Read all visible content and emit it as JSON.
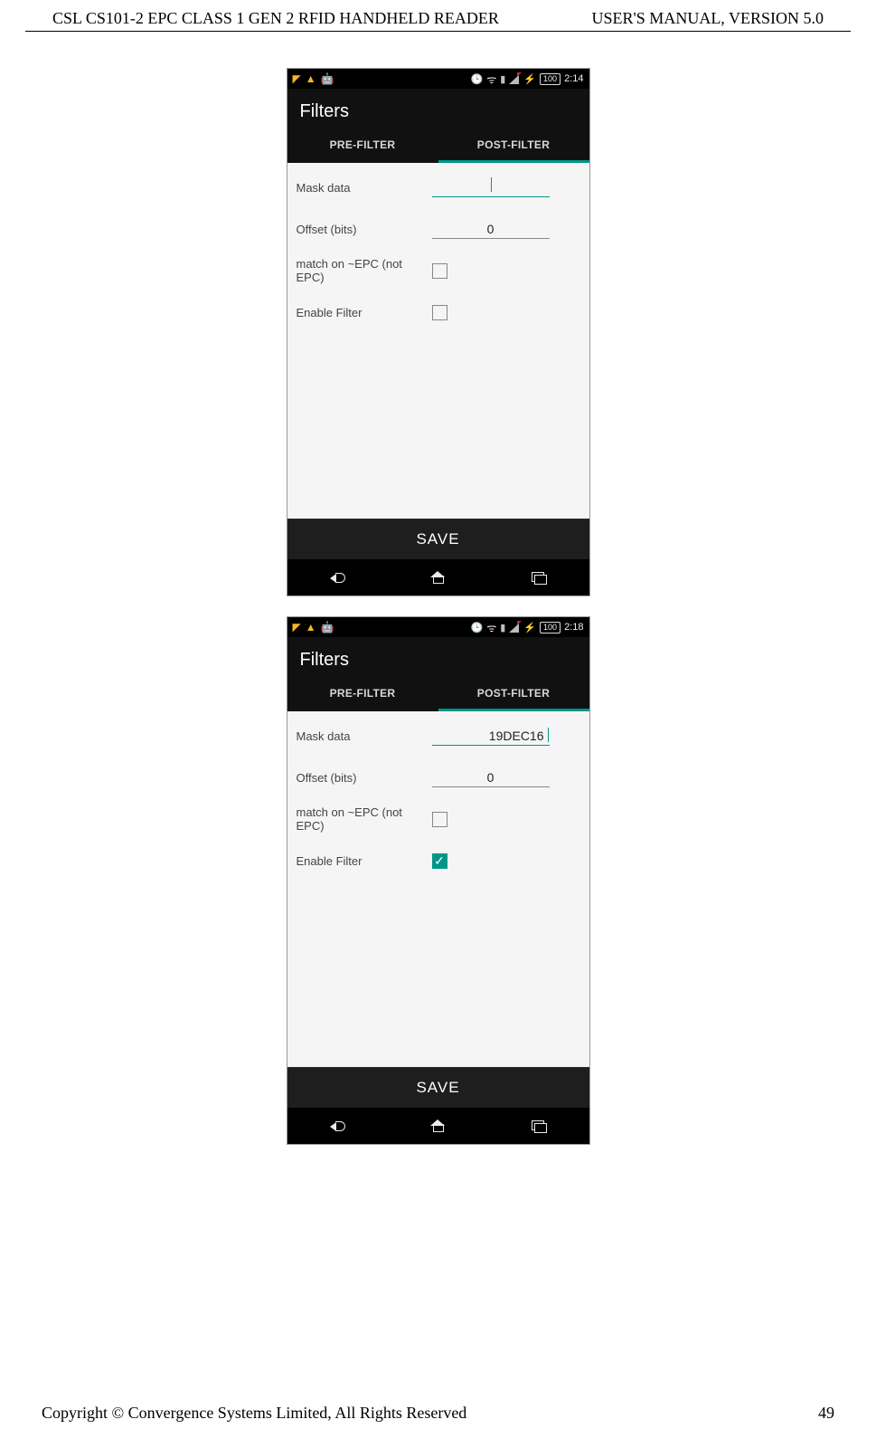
{
  "doc_header": {
    "left": "CSL CS101-2 EPC CLASS 1 GEN 2 RFID HANDHELD READER",
    "right": "USER'S  MANUAL,  VERSION  5.0"
  },
  "footer": {
    "copyright": "Copyright © Convergence Systems Limited, All Rights Reserved",
    "page": "49"
  },
  "shot1": {
    "status_time": "2:14",
    "battery": "100",
    "app_title": "Filters",
    "tab_pre": "PRE-FILTER",
    "tab_post": "POST-FILTER",
    "label_mask": "Mask data",
    "label_offset": "Offset (bits)",
    "label_match": "match on ~EPC (not EPC)",
    "label_enable": "Enable Filter",
    "value_mask": "",
    "value_offset": "0",
    "save_label": "SAVE",
    "match_checked": false,
    "enable_checked": false
  },
  "shot2": {
    "status_time": "2:18",
    "battery": "100",
    "app_title": "Filters",
    "tab_pre": "PRE-FILTER",
    "tab_post": "POST-FILTER",
    "label_mask": "Mask data",
    "label_offset": "Offset (bits)",
    "label_match": "match on ~EPC (not EPC)",
    "label_enable": "Enable Filter",
    "value_mask": "19DEC16",
    "value_offset": "0",
    "save_label": "SAVE",
    "match_checked": false,
    "enable_checked": true
  }
}
